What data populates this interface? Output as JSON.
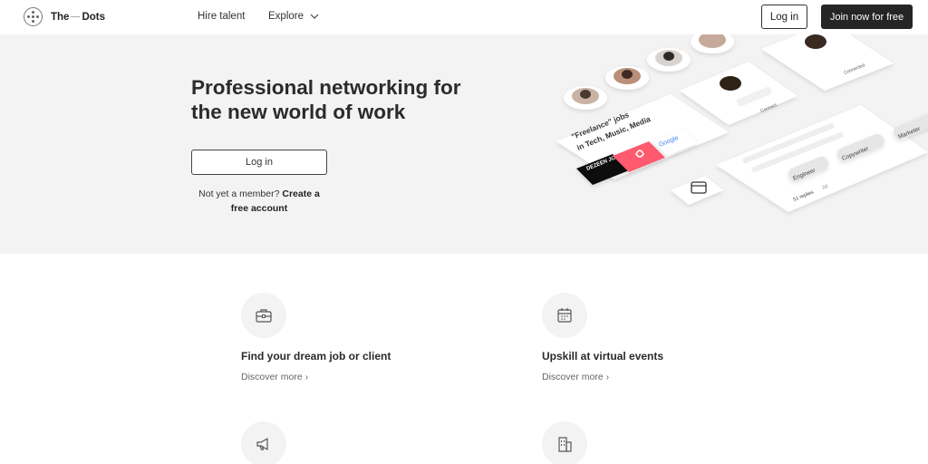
{
  "header": {
    "logo_left": "The",
    "logo_right": "Dots",
    "nav_hire": "Hire talent",
    "nav_explore": "Explore",
    "login_label": "Log in",
    "join_label": "Join now for free"
  },
  "hero": {
    "title_line1": "Professional networking for",
    "title_line2": "the new world of work",
    "login_label": "Log in",
    "member_prefix": "Not yet a member?",
    "member_link": "Create a free account",
    "illustration": {
      "jobs_card_text": "\"Freelance\" jobs in Tech, Music, Media",
      "brand_google": "Google",
      "brand_dezeen": "DEZEEN JOBS",
      "tag_engineer": "Engineer",
      "tag_copywriter": "Copywriter",
      "tag_marketer": "Marketer",
      "replies_text": "51 replies",
      "replies_time": "2d",
      "connect_label": "Connect",
      "connected_label": "Connected"
    }
  },
  "features": [
    {
      "icon": "briefcase-icon",
      "title": "Find your dream job or client",
      "link": "Discover more"
    },
    {
      "icon": "calendar-icon",
      "title": "Upskill at virtual events",
      "link": "Discover more"
    },
    {
      "icon": "megaphone-icon"
    },
    {
      "icon": "building-icon"
    }
  ],
  "colors": {
    "hero_bg": "#f3f3f3",
    "dark_button": "#252525",
    "airbnb": "#ff5a6e",
    "icon_circle": "#f3f3f3"
  }
}
